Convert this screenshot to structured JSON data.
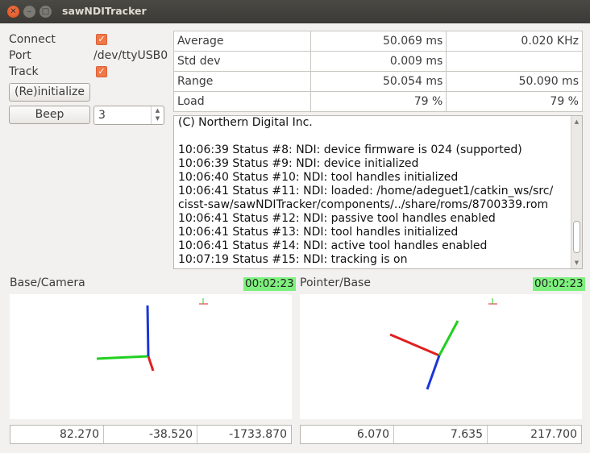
{
  "window": {
    "title": "sawNDITracker"
  },
  "controls": {
    "connect_label": "Connect",
    "port_label": "Port",
    "port_value": "/dev/ttyUSB0",
    "track_label": "Track",
    "reinit_label": "(Re)initialize",
    "beep_label": "Beep",
    "beep_count": "3"
  },
  "stats": {
    "average": {
      "label": "Average",
      "value1": "50.069 ms",
      "value2": "0.020  KHz"
    },
    "stddev": {
      "label": "Std dev",
      "value1": "0.009  ms",
      "value2": ""
    },
    "range": {
      "label": "Range",
      "value1": "50.054 ms",
      "value2": "50.090 ms"
    },
    "load": {
      "label": "Load",
      "value1": "79  %",
      "value2": "79  %"
    }
  },
  "log": [
    "(C) Northern Digital Inc.",
    "",
    "10:06:39 Status #8: NDI: device firmware is 024 (supported)",
    "10:06:39 Status #9: NDI: device initialized",
    "10:06:40 Status #10: NDI: tool handles initialized",
    "10:06:41 Status #11: NDI: loaded: /home/adeguet1/catkin_ws/src/",
    "cisst-saw/sawNDITracker/components/../share/roms/8700339.rom",
    "10:06:41 Status #12: NDI: passive tool handles enabled",
    "10:06:41 Status #13: NDI: tool handles initialized",
    "10:06:41 Status #14: NDI: active tool handles enabled",
    "10:07:19 Status #15: NDI: tracking is on"
  ],
  "views": {
    "left": {
      "title": "Base/Camera",
      "time": "00:02:23",
      "x": "82.270",
      "y": "-38.520",
      "z": "-1733.870"
    },
    "right": {
      "title": "Pointer/Base",
      "time": "00:02:23",
      "x": "6.070",
      "y": "7.635",
      "z": "217.700"
    }
  },
  "colors": {
    "x_axis": "#e02020",
    "y_axis": "#20d020",
    "z_axis": "#1a36d8",
    "timer_bg": "#7ef07e",
    "checkbox": "#f07746"
  }
}
